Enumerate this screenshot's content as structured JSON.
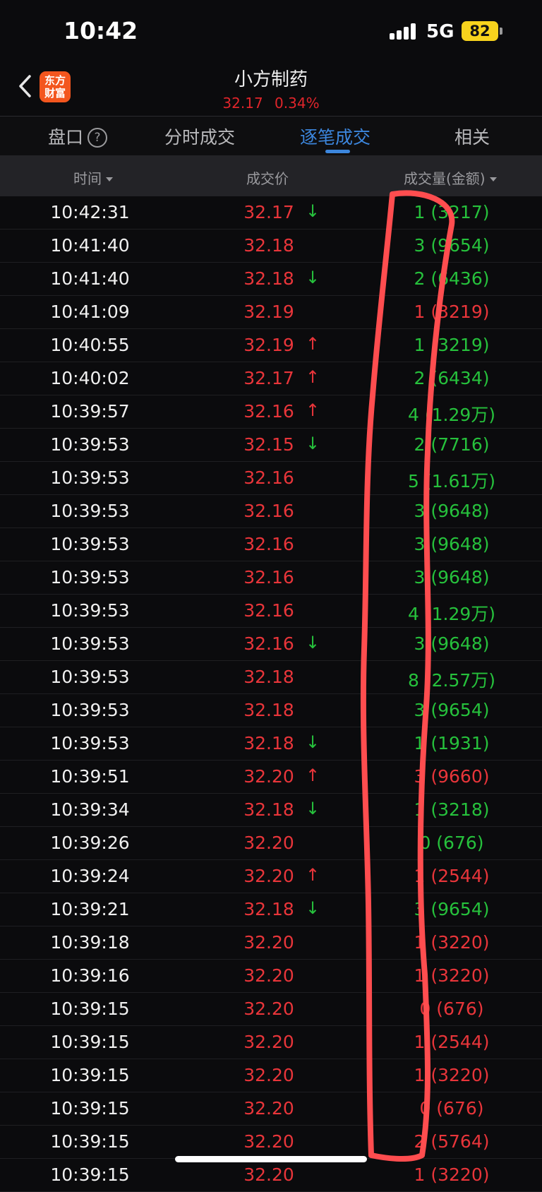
{
  "status_bar": {
    "time": "10:42",
    "network": "5G",
    "battery": "82"
  },
  "nav": {
    "logo_line1": "东方",
    "logo_line2": "财富",
    "stock_name": "小方制药",
    "price": "32.17",
    "change_pct": "0.34%"
  },
  "tabs": [
    {
      "label": "盘口",
      "help": "?"
    },
    {
      "label": "分时成交"
    },
    {
      "label": "逐笔成交",
      "active": true
    },
    {
      "label": "相关"
    }
  ],
  "table": {
    "headers": {
      "time": "时间",
      "price": "成交价",
      "volume": "成交量(金额)"
    },
    "rows": [
      {
        "time": "10:42:31",
        "price": "32.17",
        "arrow": "↓",
        "arrow_color": "green",
        "volume": "1 (3217)",
        "volume_color": "green"
      },
      {
        "time": "10:41:40",
        "price": "32.18",
        "arrow": "",
        "arrow_color": "",
        "volume": "3 (9654)",
        "volume_color": "green"
      },
      {
        "time": "10:41:40",
        "price": "32.18",
        "arrow": "↓",
        "arrow_color": "green",
        "volume": "2 (6436)",
        "volume_color": "green"
      },
      {
        "time": "10:41:09",
        "price": "32.19",
        "arrow": "",
        "arrow_color": "",
        "volume": "1 (3219)",
        "volume_color": "red"
      },
      {
        "time": "10:40:55",
        "price": "32.19",
        "arrow": "↑",
        "arrow_color": "red",
        "volume": "1 (3219)",
        "volume_color": "green"
      },
      {
        "time": "10:40:02",
        "price": "32.17",
        "arrow": "↑",
        "arrow_color": "red",
        "volume": "2 (6434)",
        "volume_color": "green"
      },
      {
        "time": "10:39:57",
        "price": "32.16",
        "arrow": "↑",
        "arrow_color": "red",
        "volume": "4 (1.29万)",
        "volume_color": "green"
      },
      {
        "time": "10:39:53",
        "price": "32.15",
        "arrow": "↓",
        "arrow_color": "green",
        "volume": "2 (7716)",
        "volume_color": "green"
      },
      {
        "time": "10:39:53",
        "price": "32.16",
        "arrow": "",
        "arrow_color": "",
        "volume": "5 (1.61万)",
        "volume_color": "green"
      },
      {
        "time": "10:39:53",
        "price": "32.16",
        "arrow": "",
        "arrow_color": "",
        "volume": "3 (9648)",
        "volume_color": "green"
      },
      {
        "time": "10:39:53",
        "price": "32.16",
        "arrow": "",
        "arrow_color": "",
        "volume": "3 (9648)",
        "volume_color": "green"
      },
      {
        "time": "10:39:53",
        "price": "32.16",
        "arrow": "",
        "arrow_color": "",
        "volume": "3 (9648)",
        "volume_color": "green"
      },
      {
        "time": "10:39:53",
        "price": "32.16",
        "arrow": "",
        "arrow_color": "",
        "volume": "4 (1.29万)",
        "volume_color": "green"
      },
      {
        "time": "10:39:53",
        "price": "32.16",
        "arrow": "↓",
        "arrow_color": "green",
        "volume": "3 (9648)",
        "volume_color": "green"
      },
      {
        "time": "10:39:53",
        "price": "32.18",
        "arrow": "",
        "arrow_color": "",
        "volume": "8 (2.57万)",
        "volume_color": "green"
      },
      {
        "time": "10:39:53",
        "price": "32.18",
        "arrow": "",
        "arrow_color": "",
        "volume": "3 (9654)",
        "volume_color": "green"
      },
      {
        "time": "10:39:53",
        "price": "32.18",
        "arrow": "↓",
        "arrow_color": "green",
        "volume": "1 (1931)",
        "volume_color": "green"
      },
      {
        "time": "10:39:51",
        "price": "32.20",
        "arrow": "↑",
        "arrow_color": "red",
        "volume": "3 (9660)",
        "volume_color": "red"
      },
      {
        "time": "10:39:34",
        "price": "32.18",
        "arrow": "↓",
        "arrow_color": "green",
        "volume": "1 (3218)",
        "volume_color": "green"
      },
      {
        "time": "10:39:26",
        "price": "32.20",
        "arrow": "",
        "arrow_color": "",
        "volume": "0 (676)",
        "volume_color": "green"
      },
      {
        "time": "10:39:24",
        "price": "32.20",
        "arrow": "↑",
        "arrow_color": "red",
        "volume": "1 (2544)",
        "volume_color": "red"
      },
      {
        "time": "10:39:21",
        "price": "32.18",
        "arrow": "↓",
        "arrow_color": "green",
        "volume": "3 (9654)",
        "volume_color": "green"
      },
      {
        "time": "10:39:18",
        "price": "32.20",
        "arrow": "",
        "arrow_color": "",
        "volume": "1 (3220)",
        "volume_color": "red"
      },
      {
        "time": "10:39:16",
        "price": "32.20",
        "arrow": "",
        "arrow_color": "",
        "volume": "1 (3220)",
        "volume_color": "red"
      },
      {
        "time": "10:39:15",
        "price": "32.20",
        "arrow": "",
        "arrow_color": "",
        "volume": "0 (676)",
        "volume_color": "red"
      },
      {
        "time": "10:39:15",
        "price": "32.20",
        "arrow": "",
        "arrow_color": "",
        "volume": "1 (2544)",
        "volume_color": "red"
      },
      {
        "time": "10:39:15",
        "price": "32.20",
        "arrow": "",
        "arrow_color": "",
        "volume": "1 (3220)",
        "volume_color": "red"
      },
      {
        "time": "10:39:15",
        "price": "32.20",
        "arrow": "",
        "arrow_color": "",
        "volume": "0 (676)",
        "volume_color": "red"
      },
      {
        "time": "10:39:15",
        "price": "32.20",
        "arrow": "",
        "arrow_color": "",
        "volume": "2 (5764)",
        "volume_color": "red"
      },
      {
        "time": "10:39:15",
        "price": "32.20",
        "arrow": "",
        "arrow_color": "",
        "volume": "1 (3220)",
        "volume_color": "red"
      }
    ]
  },
  "colors": {
    "up_red": "#e8353a",
    "down_green": "#26c13c",
    "accent_blue": "#3c86dd",
    "annotation": "#ff4d4f"
  }
}
